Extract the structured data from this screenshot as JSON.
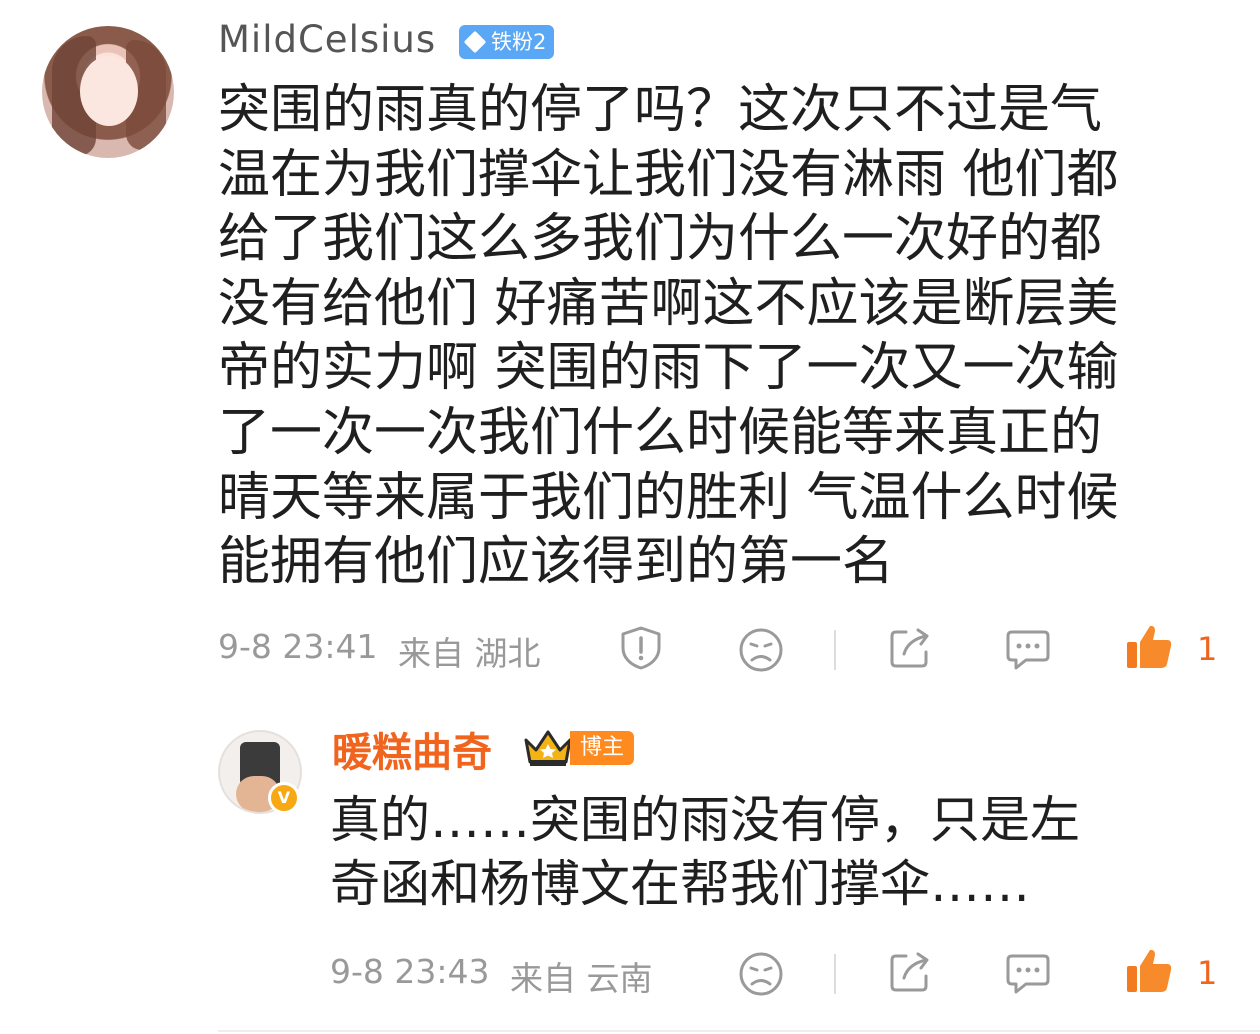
{
  "comment": {
    "username": "MildCelsius",
    "fan_badge": "铁粉2",
    "text_lines": [
      "突围的雨真的停了吗？这次只不过是气",
      "温在为我们撑伞让我们没有淋雨 他们都",
      "给了我们这么多我们为什么一次好的都",
      "没有给他们 好痛苦啊这不应该是断层美",
      "帝的实力啊 突围的雨下了一次又一次输",
      "了一次一次我们什么时候能等来真正的",
      "晴天等来属于我们的胜利 气温什么时候",
      "能拥有他们应该得到的第一名"
    ],
    "time": "9-8 23:41",
    "location": "来自 湖北",
    "like_count": "1",
    "icons": [
      "report-icon",
      "dislike-face-icon",
      "share-icon",
      "comment-icon",
      "thumbs-up-icon"
    ]
  },
  "reply": {
    "username": "暖糕曲奇",
    "badge": "博主",
    "text_lines": [
      "真的……突围的雨没有停，只是左",
      "奇函和杨博文在帮我们撑伞……"
    ],
    "time": "9-8 23:43",
    "location": "来自 云南",
    "like_count": "1",
    "icons": [
      "dislike-face-icon",
      "share-icon",
      "comment-icon",
      "thumbs-up-icon"
    ]
  },
  "colors": {
    "accent": "#f1641e",
    "fan_badge": "#5aa7f5",
    "meta": "#999999"
  }
}
